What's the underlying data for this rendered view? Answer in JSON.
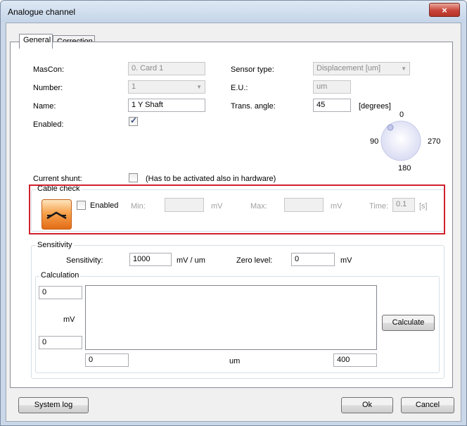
{
  "window": {
    "title": "Analogue channel",
    "close_glyph": "×"
  },
  "tabs": [
    {
      "label": "General"
    },
    {
      "label": "Correction"
    }
  ],
  "fields": {
    "mascon": {
      "label": "MasCon:",
      "value": "0. Card 1"
    },
    "number": {
      "label": "Number:",
      "value": "1"
    },
    "name": {
      "label": "Name:",
      "value": "1 Y Shaft"
    },
    "enabled": {
      "label": "Enabled:"
    },
    "sensor_type": {
      "label": "Sensor type:",
      "value": "Displacement [um]"
    },
    "eu": {
      "label": "E.U.:",
      "value": "um"
    },
    "trans_angle": {
      "label": "Trans. angle:",
      "value": "45",
      "unit": "[degrees]"
    },
    "current_shunt": {
      "label": "Current shunt:",
      "note": "(Has to be activated also in hardware)"
    }
  },
  "dial": {
    "top": "0",
    "left": "90",
    "right": "270",
    "bottom": "180"
  },
  "cable_check": {
    "title": "Cable check",
    "enabled_label": "Enabled",
    "min_label": "Min:",
    "min_unit": "mV",
    "max_label": "Max:",
    "max_unit": "mV",
    "time_label": "Time:",
    "time_value": "0.1",
    "time_unit": "[s]"
  },
  "sensitivity": {
    "title": "Sensitivity",
    "sensitivity_label": "Sensitivity:",
    "sensitivity_value": "1000",
    "sensitivity_unit": "mV / um",
    "zero_label": "Zero level:",
    "zero_value": "0",
    "zero_unit": "mV"
  },
  "calculation": {
    "title": "Calculation",
    "y_top": "0",
    "y_unit": "mV",
    "y_bottom": "0",
    "x_left": "0",
    "x_unit": "um",
    "x_right": "400",
    "calculate_label": "Calculate"
  },
  "buttons": {
    "system_log": "System log",
    "ok": "Ok",
    "cancel": "Cancel"
  }
}
